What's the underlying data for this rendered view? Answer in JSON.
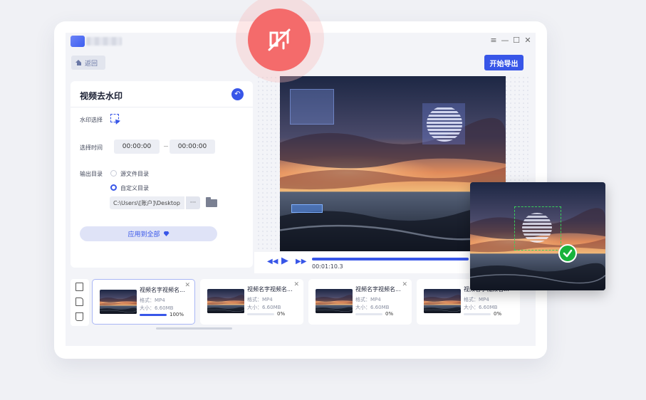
{
  "window": {
    "back_label": "返回",
    "export_label": "开始导出",
    "controls": [
      "≡",
      "—",
      "☐",
      "✕"
    ]
  },
  "panel": {
    "title": "视频去水印",
    "watermark_select_label": "水印选择",
    "time_label": "选择时间",
    "start_time": "00:00:00",
    "end_time": "00:00:00",
    "output_label": "输出目录",
    "option_source": "源文件目录",
    "option_custom": "自定义目录",
    "selected_option": "custom",
    "path": "C:\\Users\\[账户]\\Desktop",
    "path_more": "···",
    "apply_label": "应用到全部"
  },
  "player": {
    "time": "00:01:10.3",
    "progress": 1.0
  },
  "clips": [
    {
      "name": "视频名字视频名...",
      "format": "格式：MP4",
      "size": "大小：6.60MB",
      "progress": 1.0,
      "pct": "100%",
      "selected": true
    },
    {
      "name": "视频名字视频名...",
      "format": "格式：MP4",
      "size": "大小：6.60MB",
      "progress": 0,
      "pct": "0%",
      "selected": false
    },
    {
      "name": "视频名字视频名...",
      "format": "格式：MP4",
      "size": "大小：6.60MB",
      "progress": 0,
      "pct": "0%",
      "selected": false
    },
    {
      "name": "视频名字视频名...",
      "format": "格式：MP4",
      "size": "大小：6.60MB",
      "progress": 0,
      "pct": "0%",
      "selected": false
    }
  ],
  "colors": {
    "accent": "#3856e8",
    "badge": "#f46b6b",
    "success": "#18b33c"
  }
}
